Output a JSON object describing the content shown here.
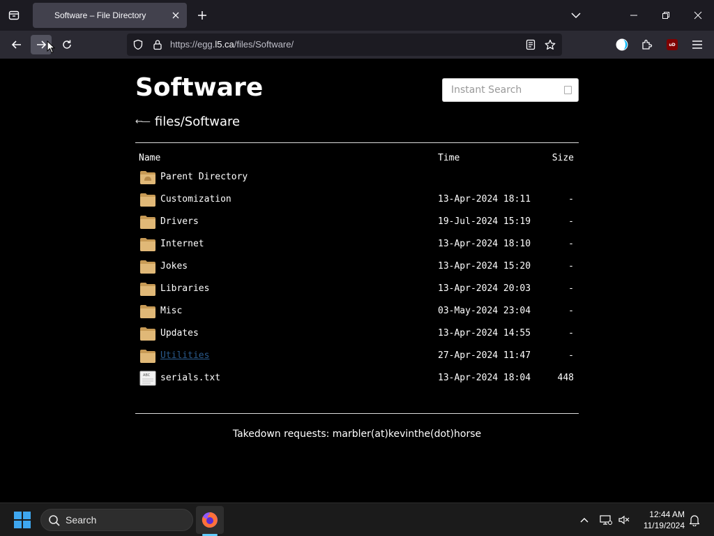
{
  "browser": {
    "tab_title": "Software – File Directory",
    "url_prefix": "https://egg.",
    "url_host": "l5.ca",
    "url_path": "/files/Software/"
  },
  "page": {
    "title": "Software",
    "search_placeholder": "Instant Search",
    "breadcrumb_path": "files/Software",
    "columns": {
      "name": "Name",
      "time": "Time",
      "size": "Size"
    },
    "rows": [
      {
        "name": "Parent Directory",
        "time": "",
        "size": "",
        "icon": "parent-folder-icon"
      },
      {
        "name": "Customization",
        "time": "13-Apr-2024 18:11",
        "size": "-",
        "icon": "folder-icon"
      },
      {
        "name": "Drivers",
        "time": "19-Jul-2024 15:19",
        "size": "-",
        "icon": "folder-icon"
      },
      {
        "name": "Internet",
        "time": "13-Apr-2024 18:10",
        "size": "-",
        "icon": "folder-icon"
      },
      {
        "name": "Jokes",
        "time": "13-Apr-2024 15:20",
        "size": "-",
        "icon": "folder-icon"
      },
      {
        "name": "Libraries",
        "time": "13-Apr-2024 20:03",
        "size": "-",
        "icon": "folder-icon"
      },
      {
        "name": "Misc",
        "time": "03-May-2024 23:04",
        "size": "-",
        "icon": "folder-icon"
      },
      {
        "name": "Updates",
        "time": "13-Apr-2024 14:55",
        "size": "-",
        "icon": "folder-icon"
      },
      {
        "name": "Utilities",
        "time": "27-Apr-2024 11:47",
        "size": "-",
        "icon": "folder-icon",
        "visited": true
      },
      {
        "name": "serials.txt",
        "time": "13-Apr-2024 18:04",
        "size": "448",
        "icon": "text-file-icon"
      }
    ],
    "footer": "Takedown requests: marbler(at)kevinthe(dot)horse"
  },
  "taskbar": {
    "search_label": "Search",
    "time": "12:44 AM",
    "date": "11/19/2024"
  },
  "colors": {
    "visited_link": "#2a5a8c",
    "folder": "#dcb67a",
    "taskbar_accent": "#62cdfe"
  }
}
